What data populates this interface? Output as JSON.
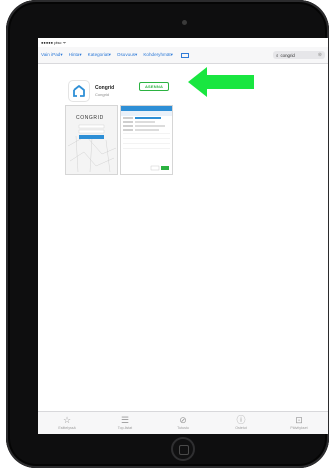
{
  "status": {
    "carrier": "●●●●● ptsc ᯤ"
  },
  "nav": {
    "items": [
      "Vain iPad▾",
      "Hinta▾",
      "Kategoriat▾",
      "Osuvuus▾",
      "Kohderyhmät▾"
    ],
    "search_value": "congrid"
  },
  "app": {
    "name": "Congrid",
    "developer": "Congrid",
    "get_label": "ASENNA",
    "accent": "#2bb241",
    "icon_color": "#2e8fd6"
  },
  "screenshot1": {
    "logo_text": "CONGRID"
  },
  "tabs": [
    {
      "label": "Esittelyssä",
      "icon": "star-icon"
    },
    {
      "label": "Top-listat",
      "icon": "list-icon"
    },
    {
      "label": "Tutustu",
      "icon": "compass-icon"
    },
    {
      "label": "Ostetut",
      "icon": "purchased-icon"
    },
    {
      "label": "Päivitykset",
      "icon": "updates-icon"
    }
  ],
  "annotation": {
    "arrow_color": "#19e640"
  }
}
